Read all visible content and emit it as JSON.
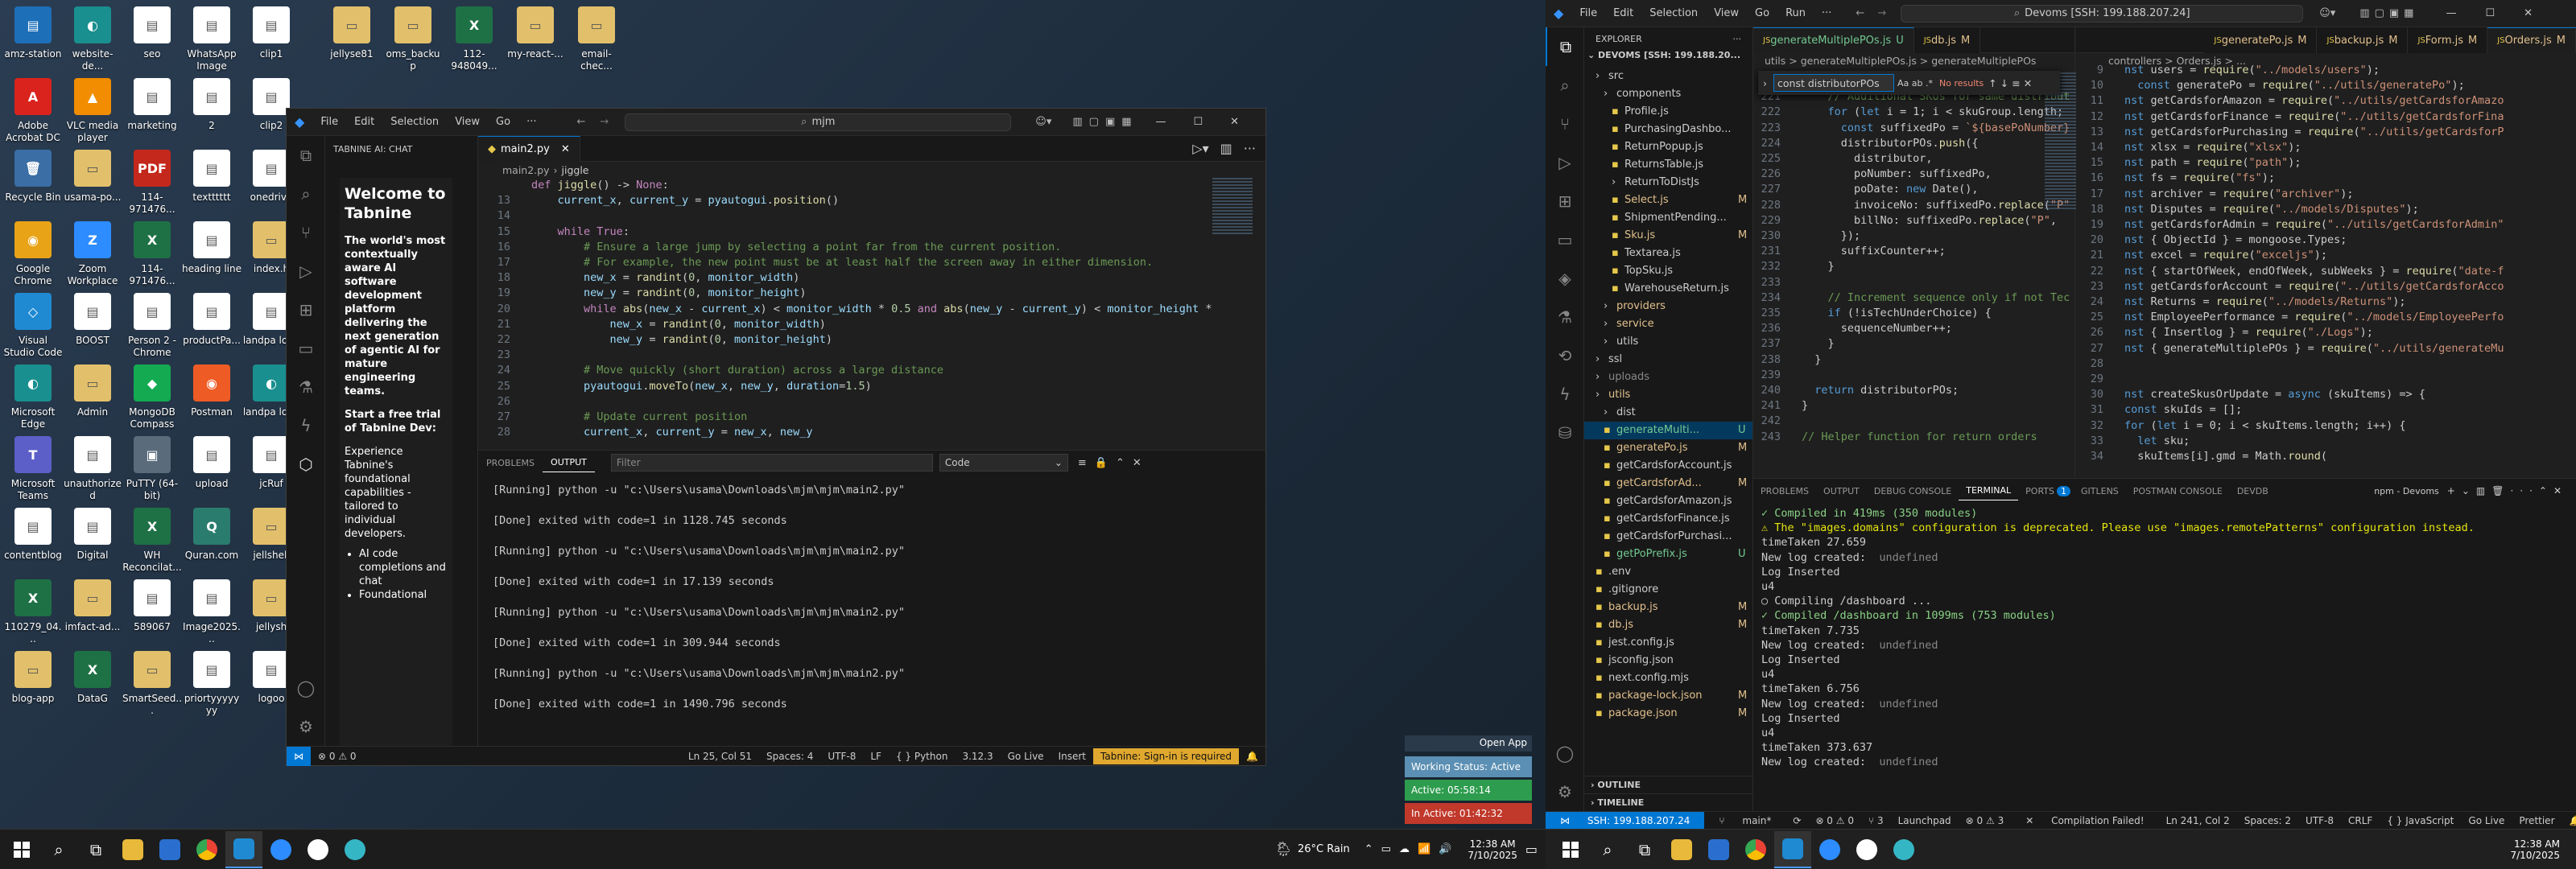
{
  "desktop_icons": [
    {
      "label": "amz-station",
      "color": "#1d6fb8",
      "glyph": "▤"
    },
    {
      "label": "Adobe Acrobat DC",
      "color": "#d9231c",
      "glyph": "A"
    },
    {
      "label": "Recycle Bin",
      "color": "#3a6ea5",
      "glyph": "🗑"
    },
    {
      "label": "Google Chrome",
      "color": "#e8a317",
      "glyph": "◉"
    },
    {
      "label": "Visual Studio Code",
      "color": "#1f8ad2",
      "glyph": "◇"
    },
    {
      "label": "Microsoft Edge",
      "color": "#1a8f8f",
      "glyph": "◐"
    },
    {
      "label": "Microsoft Teams",
      "color": "#5b5fc7",
      "glyph": "T"
    },
    {
      "label": "contentblog",
      "color": "#ffffff",
      "glyph": "▤"
    },
    {
      "label": "110279_04...",
      "color": "#1e7145",
      "glyph": "X"
    },
    {
      "label": "blog-app",
      "color": "#e2c06b",
      "glyph": "▭"
    },
    {
      "label": "website-de...",
      "color": "#1a8f8f",
      "glyph": "◐"
    },
    {
      "label": "VLC media player",
      "color": "#f28c00",
      "glyph": "▲"
    },
    {
      "label": "usama-po...",
      "color": "#e2c06b",
      "glyph": "▭"
    },
    {
      "label": "Zoom Workplace",
      "color": "#2d8cff",
      "glyph": "Z"
    },
    {
      "label": "BOOST",
      "color": "#ffffff",
      "glyph": "▤"
    },
    {
      "label": "Admin",
      "color": "#e2c06b",
      "glyph": "▭"
    },
    {
      "label": "unauthorized",
      "color": "#ffffff",
      "glyph": "▤"
    },
    {
      "label": "Digital",
      "color": "#ffffff",
      "glyph": "▤"
    },
    {
      "label": "imfact-ad...",
      "color": "#e2c06b",
      "glyph": "▭"
    },
    {
      "label": "DataG",
      "color": "#1e7145",
      "glyph": "X"
    },
    {
      "label": "seo",
      "color": "#ffffff",
      "glyph": "▤"
    },
    {
      "label": "marketing",
      "color": "#ffffff",
      "glyph": "▤"
    },
    {
      "label": "114-971476...",
      "color": "#c4281c",
      "glyph": "PDF"
    },
    {
      "label": "114-971476...",
      "color": "#1e7145",
      "glyph": "X"
    },
    {
      "label": "Person 2 - Chrome",
      "color": "#ffffff",
      "glyph": "▤"
    },
    {
      "label": "MongoDB Compass",
      "color": "#13aa52",
      "glyph": "◆"
    },
    {
      "label": "PuTTY (64-bit)",
      "color": "#5a6b7c",
      "glyph": "▣"
    },
    {
      "label": "WH Reconcilat...",
      "color": "#1e7145",
      "glyph": "X"
    },
    {
      "label": "589067",
      "color": "#ffffff",
      "glyph": "▤"
    },
    {
      "label": "SmartSeed...",
      "color": "#e2c06b",
      "glyph": "▭"
    },
    {
      "label": "WhatsApp Image 2025...",
      "color": "#ffffff",
      "glyph": "▤"
    },
    {
      "label": "2",
      "color": "#ffffff",
      "glyph": "▤"
    },
    {
      "label": "textttttt",
      "color": "#ffffff",
      "glyph": "▤"
    },
    {
      "label": "heading line",
      "color": "#ffffff",
      "glyph": "▤"
    },
    {
      "label": "productPa...",
      "color": "#ffffff",
      "glyph": "▤"
    },
    {
      "label": "Postman",
      "color": "#ef5b25",
      "glyph": "◉"
    },
    {
      "label": "upload",
      "color": "#ffffff",
      "glyph": "▤"
    },
    {
      "label": "Quran.com",
      "color": "#2a7d6e",
      "glyph": "Q"
    },
    {
      "label": "Image2025...",
      "color": "#ffffff",
      "glyph": "▤"
    },
    {
      "label": "priortyyyyyyy",
      "color": "#ffffff",
      "glyph": "▤"
    },
    {
      "label": "clip1",
      "color": "#ffffff",
      "glyph": "▤"
    },
    {
      "label": "clip2",
      "color": "#ffffff",
      "glyph": "▤"
    },
    {
      "label": "onedrive",
      "color": "#ffffff",
      "glyph": "▤"
    },
    {
      "label": "index.h",
      "color": "#e2c06b",
      "glyph": "▭"
    },
    {
      "label": "landpa logo",
      "color": "#ffffff",
      "glyph": "▤"
    },
    {
      "label": "landpa logo",
      "color": "#1a8f8f",
      "glyph": "◐"
    },
    {
      "label": "jcRuf",
      "color": "#ffffff",
      "glyph": "▤"
    },
    {
      "label": "jellshell",
      "color": "#e2c06b",
      "glyph": "▭"
    },
    {
      "label": "jellysh",
      "color": "#e2c06b",
      "glyph": "▭"
    },
    {
      "label": "logoo",
      "color": "#ffffff",
      "glyph": "▤"
    },
    {
      "label": "jellyse81",
      "color": "#e2c06b",
      "glyph": "▭"
    },
    {
      "label": "oms_backup",
      "color": "#e2c06b",
      "glyph": "▭"
    },
    {
      "label": "112-948049...",
      "color": "#1e7145",
      "glyph": "X"
    },
    {
      "label": "my-react-...",
      "color": "#e2c06b",
      "glyph": "▭"
    },
    {
      "label": "email-chec...",
      "color": "#e2c06b",
      "glyph": "▭"
    }
  ],
  "left_vscode": {
    "menu": [
      "File",
      "Edit",
      "Selection",
      "View",
      "Go",
      "···"
    ],
    "search": "mjm",
    "panel_title": "TABNINE AI: CHAT",
    "chat": {
      "heading": "Welcome to Tabnine",
      "p1": "The world's most contextually aware AI software development platform delivering the next generation of agentic AI for mature engineering teams.",
      "p2": "Start a free trial of Tabnine Dev:",
      "p3": "Experience Tabnine's foundational capabilities - tailored to individual developers.",
      "bullets": [
        "AI code completions and chat",
        "Foundational"
      ]
    },
    "tab": "main2.py",
    "breadcrumb": [
      "main2.py",
      "jiggle"
    ],
    "code": [
      {
        "n": "",
        "t": "def jiggle() -> None:"
      },
      {
        "n": "13",
        "t": "    current_x, current_y = pyautogui.position()"
      },
      {
        "n": "14",
        "t": ""
      },
      {
        "n": "15",
        "t": "    while True:"
      },
      {
        "n": "16",
        "t": "        # Ensure a large jump by selecting a point far from the current position."
      },
      {
        "n": "17",
        "t": "        # For example, the new point must be at least half the screen away in either dimension."
      },
      {
        "n": "18",
        "t": "        new_x = randint(0, monitor_width)"
      },
      {
        "n": "19",
        "t": "        new_y = randint(0, monitor_height)"
      },
      {
        "n": "20",
        "t": "        while abs(new_x - current_x) < monitor_width * 0.5 and abs(new_y - current_y) < monitor_height *"
      },
      {
        "n": "21",
        "t": "            new_x = randint(0, monitor_width)"
      },
      {
        "n": "22",
        "t": "            new_y = randint(0, monitor_height)"
      },
      {
        "n": "23",
        "t": ""
      },
      {
        "n": "24",
        "t": "        # Move quickly (short duration) across a large distance"
      },
      {
        "n": "25",
        "t": "        pyautogui.moveTo(new_x, new_y, duration=1.5)"
      },
      {
        "n": "26",
        "t": ""
      },
      {
        "n": "27",
        "t": "        # Update current position"
      },
      {
        "n": "28",
        "t": "        current_x, current_y = new_x, new_y"
      }
    ],
    "panel_tabs": [
      "PROBLEMS",
      "OUTPUT"
    ],
    "filter_placeholder": "Filter",
    "output_channel": "Code",
    "output": [
      "[Running] python -u \"c:\\Users\\usama\\Downloads\\mjm\\mjm\\main2.py\"",
      "[Done] exited with code=1 in 1128.745 seconds",
      "[Running] python -u \"c:\\Users\\usama\\Downloads\\mjm\\mjm\\main2.py\"",
      "[Done] exited with code=1 in 17.139 seconds",
      "[Running] python -u \"c:\\Users\\usama\\Downloads\\mjm\\mjm\\main2.py\"",
      "[Done] exited with code=1 in 309.944 seconds",
      "[Running] python -u \"c:\\Users\\usama\\Downloads\\mjm\\mjm\\main2.py\"",
      "[Done] exited with code=1 in 1490.796 seconds"
    ],
    "status": {
      "errors": "⊗ 0 ⚠ 0",
      "pos": "Ln 25, Col 51",
      "spaces": "Spaces: 4",
      "enc": "UTF-8",
      "eol": "LF",
      "lang": "{ } Python",
      "ver": "3.12.3",
      "golive": "Go Live",
      "insert": "Insert",
      "tabnine": "Tabnine: Sign-in is required"
    },
    "notif": {
      "open_app": "Open App",
      "working": "Working Status: Active",
      "active": "Active: 05:58:14",
      "inactive": "In Active: 01:42:32"
    }
  },
  "right_vscode": {
    "menu": [
      "File",
      "Edit",
      "Selection",
      "View",
      "Go",
      "Run",
      "···"
    ],
    "search": "Devoms [SSH: 199.188.207.24]",
    "explorer_title": "EXPLORER",
    "root": "DEVOMS [SSH: 199.188.20...",
    "tree": [
      {
        "d": 1,
        "t": "src",
        "c": "#ccc",
        "b": ""
      },
      {
        "d": 2,
        "t": "components",
        "c": "#ccc",
        "b": ""
      },
      {
        "d": 3,
        "t": "Profile.js",
        "c": "#ccc",
        "b": ""
      },
      {
        "d": 3,
        "t": "PurchasingDashbo...",
        "c": "#ccc",
        "b": ""
      },
      {
        "d": 3,
        "t": "ReturnPopup.js",
        "c": "#ccc",
        "b": ""
      },
      {
        "d": 3,
        "t": "ReturnsTable.js",
        "c": "#ccc",
        "b": ""
      },
      {
        "d": 3,
        "t": "ReturnToDistJs",
        "c": "#ccc",
        "b": ""
      },
      {
        "d": 3,
        "t": "Select.js",
        "c": "#e2c08d",
        "b": "M"
      },
      {
        "d": 3,
        "t": "ShipmentPending...",
        "c": "#ccc",
        "b": ""
      },
      {
        "d": 3,
        "t": "Sku.js",
        "c": "#e2c08d",
        "b": "M"
      },
      {
        "d": 3,
        "t": "Textarea.js",
        "c": "#ccc",
        "b": ""
      },
      {
        "d": 3,
        "t": "TopSku.js",
        "c": "#ccc",
        "b": ""
      },
      {
        "d": 3,
        "t": "WarehouseReturn.js",
        "c": "#ccc",
        "b": ""
      },
      {
        "d": 2,
        "t": "providers",
        "c": "#e2c08d",
        "b": ""
      },
      {
        "d": 2,
        "t": "service",
        "c": "#e2c08d",
        "b": ""
      },
      {
        "d": 2,
        "t": "utils",
        "c": "#ccc",
        "b": ""
      },
      {
        "d": 1,
        "t": "ssl",
        "c": "#ccc",
        "b": ""
      },
      {
        "d": 1,
        "t": "uploads",
        "c": "#888",
        "b": ""
      },
      {
        "d": 1,
        "t": "utils",
        "c": "#e2c08d",
        "b": ""
      },
      {
        "d": 2,
        "t": "dist",
        "c": "#ccc",
        "b": ""
      },
      {
        "d": 2,
        "t": "generateMulti...",
        "c": "#73c991",
        "b": "U",
        "sel": true
      },
      {
        "d": 2,
        "t": "generatePo.js",
        "c": "#e2c08d",
        "b": "M"
      },
      {
        "d": 2,
        "t": "getCardsforAccount.js",
        "c": "#ccc",
        "b": ""
      },
      {
        "d": 2,
        "t": "getCardsforAd...",
        "c": "#e2c08d",
        "b": "M"
      },
      {
        "d": 2,
        "t": "getCardsforAmazon.js",
        "c": "#ccc",
        "b": ""
      },
      {
        "d": 2,
        "t": "getCardsforFinance.js",
        "c": "#ccc",
        "b": ""
      },
      {
        "d": 2,
        "t": "getCardsforPurchasi...",
        "c": "#ccc",
        "b": ""
      },
      {
        "d": 2,
        "t": "getPoPrefix.js",
        "c": "#73c991",
        "b": "U"
      },
      {
        "d": 1,
        "t": ".env",
        "c": "#ccc",
        "b": ""
      },
      {
        "d": 1,
        "t": ".gitignore",
        "c": "#ccc",
        "b": ""
      },
      {
        "d": 1,
        "t": "backup.js",
        "c": "#e2c08d",
        "b": "M"
      },
      {
        "d": 1,
        "t": "db.js",
        "c": "#e2c08d",
        "b": "M"
      },
      {
        "d": 1,
        "t": "jest.config.js",
        "c": "#ccc",
        "b": ""
      },
      {
        "d": 1,
        "t": "jsconfig.json",
        "c": "#ccc",
        "b": ""
      },
      {
        "d": 1,
        "t": "next.config.mjs",
        "c": "#ccc",
        "b": ""
      },
      {
        "d": 1,
        "t": "package-lock.json",
        "c": "#e2c08d",
        "b": "M"
      },
      {
        "d": 1,
        "t": "package.json",
        "c": "#e2c08d",
        "b": "M"
      }
    ],
    "outline": "OUTLINE",
    "timeline": "TIMELINE",
    "tabs_left": [
      {
        "t": "generateMultiplePOs.js",
        "b": "U",
        "on": true
      },
      {
        "t": "db.js",
        "b": "M",
        "on": false
      }
    ],
    "tabs_right": [
      {
        "t": "generatePo.js",
        "b": "M",
        "on": false
      },
      {
        "t": "backup.js",
        "b": "M",
        "on": false
      },
      {
        "t": "Form.js",
        "b": "M",
        "on": false
      },
      {
        "t": "Orders.js",
        "b": "M",
        "on": true
      }
    ],
    "bc_left": "utils > generateMultiplePOs.js > generateMultiplePOs",
    "bc_right": "controllers > Orders.js > ...",
    "find": "const distributorPOs",
    "find_result": "No results",
    "code_left": [
      {
        "n": "220",
        "t": ""
      },
      {
        "n": "221",
        "t": "    // Additional SKUs for same distribut"
      },
      {
        "n": "222",
        "t": "    for (let i = 1; i < skuGroup.length;"
      },
      {
        "n": "223",
        "t": "      const suffixedPo = `${basePoNumber}"
      },
      {
        "n": "224",
        "t": "      distributorPOs.push({"
      },
      {
        "n": "225",
        "t": "        distributor,"
      },
      {
        "n": "226",
        "t": "        poNumber: suffixedPo,"
      },
      {
        "n": "227",
        "t": "        poDate: new Date(),"
      },
      {
        "n": "228",
        "t": "        invoiceNo: suffixedPo.replace(\"P\""
      },
      {
        "n": "229",
        "t": "        billNo: suffixedPo.replace(\"P\","
      },
      {
        "n": "230",
        "t": "      });"
      },
      {
        "n": "231",
        "t": "      suffixCounter++;"
      },
      {
        "n": "232",
        "t": "    }"
      },
      {
        "n": "233",
        "t": ""
      },
      {
        "n": "234",
        "t": "    // Increment sequence only if not Tec"
      },
      {
        "n": "235",
        "t": "    if (!isTechUnderChoice) {"
      },
      {
        "n": "236",
        "t": "      sequenceNumber++;"
      },
      {
        "n": "237",
        "t": "    }"
      },
      {
        "n": "238",
        "t": "  }"
      },
      {
        "n": "239",
        "t": ""
      },
      {
        "n": "240",
        "t": "  return distributorPOs;"
      },
      {
        "n": "241",
        "t": "}"
      },
      {
        "n": "242",
        "t": ""
      },
      {
        "n": "243",
        "t": "// Helper function for return orders"
      }
    ],
    "code_right": [
      {
        "n": "9",
        "t": "nst users = require(\"../models/users\");"
      },
      {
        "n": "10",
        "t": "  const generatePo = require(\"../utils/generatePo\");"
      },
      {
        "n": "11",
        "t": "nst getCardsforAmazon = require(\"../utils/getCardsforAmazo"
      },
      {
        "n": "12",
        "t": "nst getCardsforFinance = require(\"../utils/getCardsforFina"
      },
      {
        "n": "13",
        "t": "nst getCardsforPurchasing = require(\"../utils/getCardsforP"
      },
      {
        "n": "14",
        "t": "nst xlsx = require(\"xlsx\");"
      },
      {
        "n": "15",
        "t": "nst path = require(\"path\");"
      },
      {
        "n": "16",
        "t": "nst fs = require(\"fs\");"
      },
      {
        "n": "17",
        "t": "nst archiver = require(\"archiver\");"
      },
      {
        "n": "18",
        "t": "nst Disputes = require(\"../models/Disputes\");"
      },
      {
        "n": "19",
        "t": "nst getCardsforAdmin = require(\"../utils/getCardsforAdmin\""
      },
      {
        "n": "20",
        "t": "nst { ObjectId } = mongoose.Types;"
      },
      {
        "n": "21",
        "t": "nst excel = require(\"exceljs\");"
      },
      {
        "n": "22",
        "t": "nst { startOfWeek, endOfWeek, subWeeks } = require(\"date-f"
      },
      {
        "n": "23",
        "t": "nst getCardsforAccount = require(\"../utils/getCardsforAcco"
      },
      {
        "n": "24",
        "t": "nst Returns = require(\"../models/Returns\");"
      },
      {
        "n": "25",
        "t": "nst EmployeePerformance = require(\"../models/EmployeePerfo"
      },
      {
        "n": "26",
        "t": "nst { Insertlog } = require(\"./Logs\");"
      },
      {
        "n": "27",
        "t": "nst { generateMultiplePOs } = require(\"../utils/generateMu"
      },
      {
        "n": "28",
        "t": ""
      },
      {
        "n": "29",
        "t": ""
      },
      {
        "n": "30",
        "t": "nst createSkusOrUpdate = async (skuItems) => {"
      },
      {
        "n": "31",
        "t": "const skuIds = [];"
      },
      {
        "n": "32",
        "t": "for (let i = 0; i < skuItems.length; i++) {"
      },
      {
        "n": "33",
        "t": "  let sku;"
      },
      {
        "n": "34",
        "t": "  skuItems[i].gmd = Math.round("
      }
    ],
    "panel_tabs": [
      "PROBLEMS",
      "OUTPUT",
      "DEBUG CONSOLE",
      "TERMINAL",
      "PORTS",
      "GITLENS",
      "POSTMAN CONSOLE",
      "DEVDB"
    ],
    "ports_count": "1",
    "terminal_name": "npm - Devoms",
    "terminal": [
      "✓ Compiled in 419ms (350 modules)",
      "⚠ The \"images.domains\" configuration is deprecated. Please use \"images.remotePatterns\" configuration instead.",
      "timeTaken 27.659",
      "New log created:  undefined",
      "Log Inserted",
      "u4",
      "○ Compiling /dashboard ...",
      "✓ Compiled /dashboard in 1099ms (753 modules)",
      "timeTaken 7.735",
      "New log created:  undefined",
      "Log Inserted",
      "u4",
      "timeTaken 6.756",
      "New log created:  undefined",
      "Log Inserted",
      "u4",
      "timeTaken 373.637",
      "New log created:  undefined"
    ],
    "status": {
      "remote": "SSH: 199.188.207.24",
      "branch": "main*",
      "sync": "⟳",
      "errors": "⊗ 0 ⚠ 0",
      "ports": "⑂ 3",
      "launch": "Launchpad",
      "ext": "⊗ 0 ⚠ 3",
      "compile": "Compilation Failed!",
      "pos": "Ln 241, Col 2",
      "spaces": "Spaces: 2",
      "enc": "UTF-8",
      "eol": "CRLF",
      "lang": "{ } JavaScript",
      "golive": "Go Live",
      "prettier": "Prettier"
    }
  },
  "taskbar_left": {
    "weather": "26°C  Rain",
    "time": "12:38 AM",
    "date": "7/10/2025"
  },
  "taskbar_right": {
    "time": "12:38 AM",
    "date": "7/10/2025"
  }
}
